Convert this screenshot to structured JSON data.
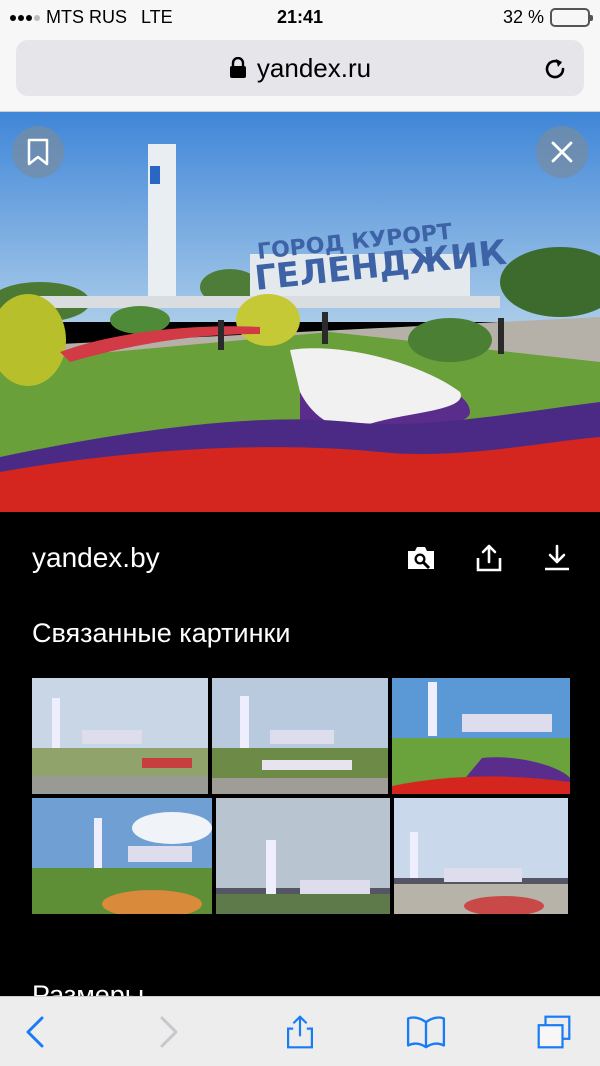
{
  "status_bar": {
    "carrier": "MTS RUS",
    "network": "LTE",
    "time": "21:41",
    "battery_percent": "32 %",
    "battery_level": 0.32
  },
  "address_bar": {
    "url": "yandex.ru",
    "lock_icon": "lock-icon",
    "reload_icon": "reload-icon"
  },
  "hero": {
    "sign_line1": "ГОРОД КУРОРТ",
    "sign_line2": "ГЕЛЕНДЖИК"
  },
  "details": {
    "source": "yandex.by",
    "actions": [
      "image-search-icon",
      "share-icon",
      "download-icon"
    ],
    "related_title": "Связанные картинки",
    "next_section_title": "Размеры"
  },
  "toolbar": {
    "items": [
      "back-icon",
      "forward-icon",
      "share-icon",
      "bookmarks-icon",
      "tabs-icon"
    ]
  },
  "colors": {
    "ios_blue": "#1a7cf5",
    "accent_yellow": "#f5c400",
    "panel_bg": "#000000"
  }
}
